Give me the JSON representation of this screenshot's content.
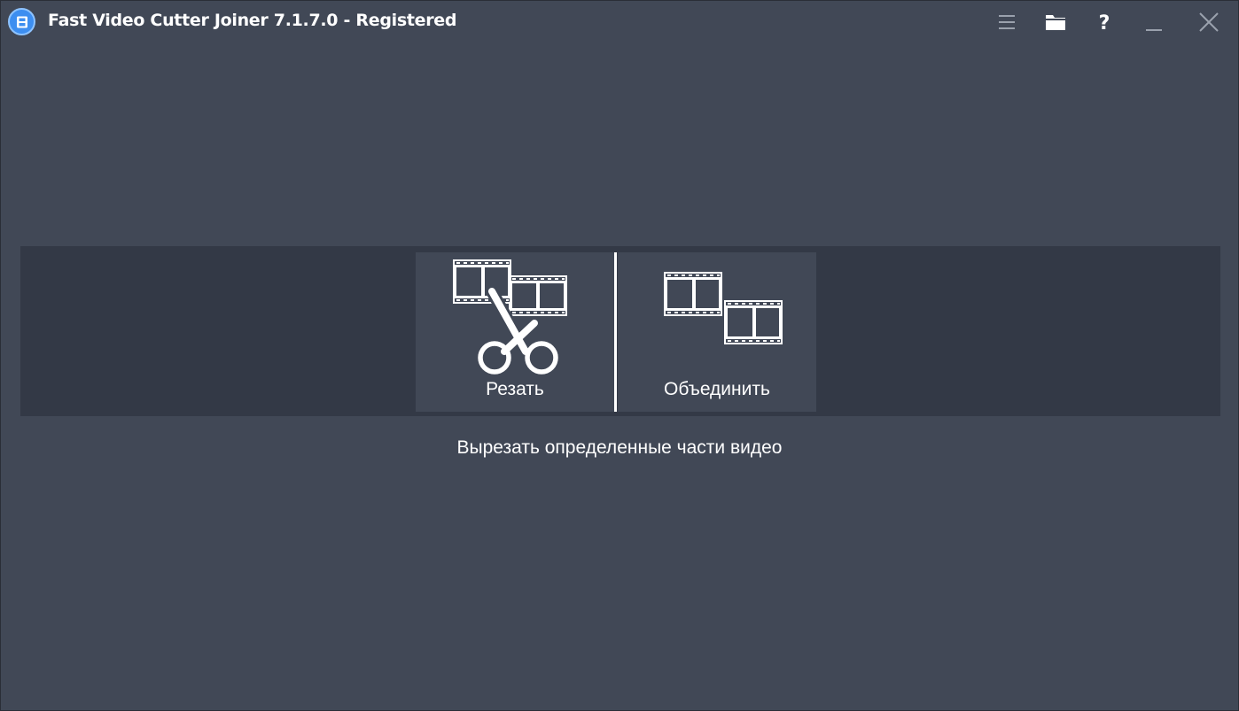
{
  "window": {
    "title": "Fast Video Cutter Joiner 7.1.7.0 - Registered",
    "app_icon": "film-strip-icon"
  },
  "titlebar_buttons": [
    {
      "name": "menu",
      "icon": "hamburger-menu-icon"
    },
    {
      "name": "open-folder",
      "icon": "folder-icon"
    },
    {
      "name": "help",
      "icon": "question-mark-icon",
      "label": "?"
    },
    {
      "name": "minimize",
      "icon": "minimize-icon"
    },
    {
      "name": "close",
      "icon": "close-icon"
    }
  ],
  "modes": {
    "cut": {
      "label": "Резать",
      "icon": "scissors-film-icon"
    },
    "join": {
      "label": "Объединить",
      "icon": "join-film-icon"
    }
  },
  "description": "Вырезать определенные части видео",
  "colors": {
    "background": "#414856",
    "band": "#333946",
    "accent_icon": "#3d8ef0",
    "text": "#ffffff",
    "titlebar_icons": "#9aa1ad"
  }
}
